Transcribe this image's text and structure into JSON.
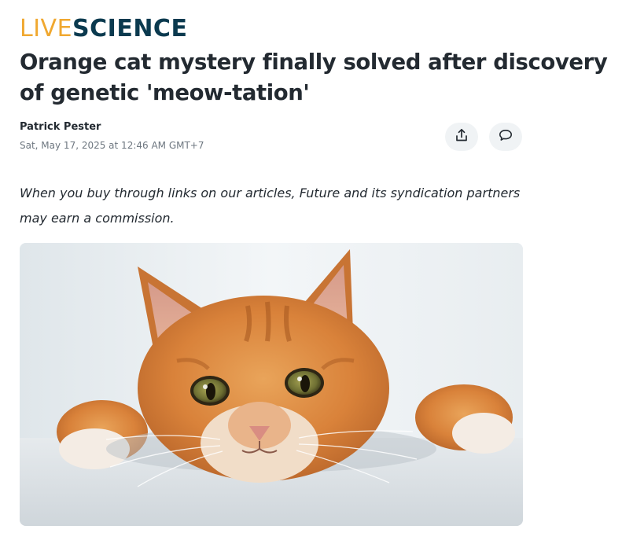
{
  "site": {
    "logo_part1": "LIVE",
    "logo_part2": "SCIENCE",
    "logo_colors": {
      "live": "#f0a830",
      "science": "#0b3a4f"
    }
  },
  "article": {
    "headline": "Orange cat mystery finally solved after discovery of genetic 'meow-tation'",
    "author": "Patrick Pester",
    "date": "Sat, May 17, 2025 at 12:46 AM GMT+7",
    "disclaimer": "When you buy through links on our articles, Future and its syndication partners may earn a commission."
  },
  "actions": {
    "share_icon": "share-icon",
    "comment_icon": "comment-icon"
  },
  "hero_image": {
    "subject": "orange-tabby-cat-photo"
  }
}
